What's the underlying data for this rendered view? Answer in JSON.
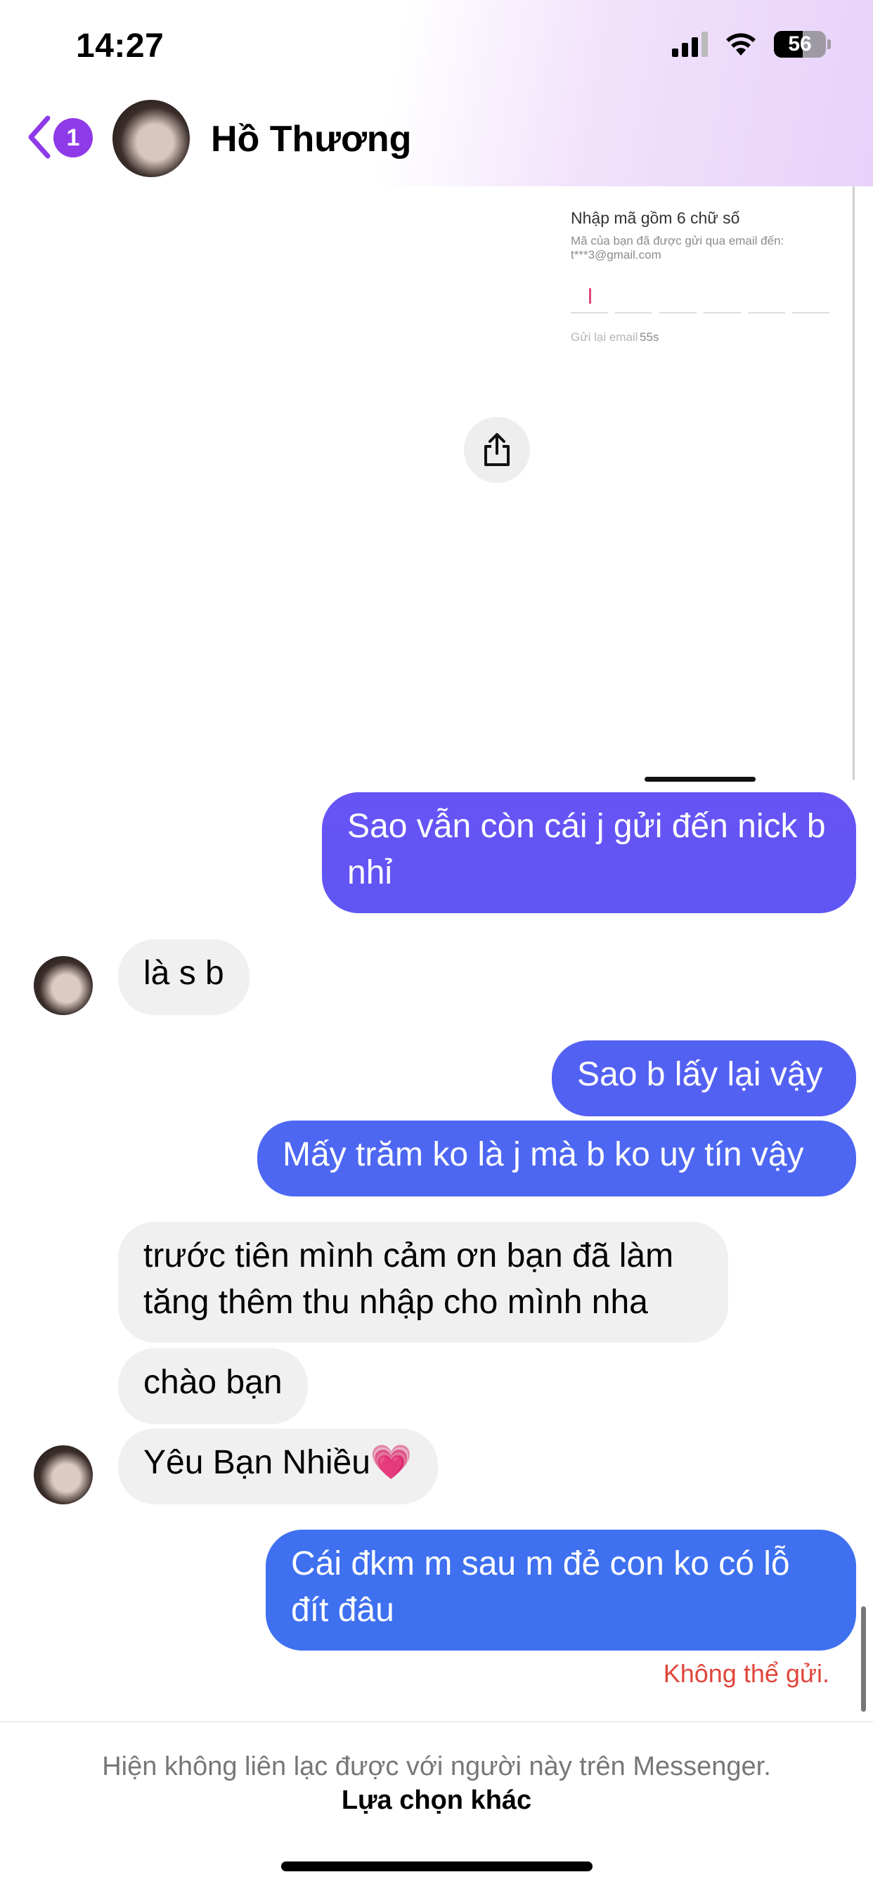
{
  "status": {
    "time": "14:27",
    "battery": "56",
    "battery_level": 0.56
  },
  "header": {
    "unread_count": "1",
    "contact_name": "Hồ Thương"
  },
  "preview": {
    "title": "Nhập mã gồm 6 chữ số",
    "subtitle": "Mã của bạn đã được gửi qua email đến: t***3@gmail.com",
    "resend_label": "Gửi lại email",
    "timer": "55s"
  },
  "messages": [
    {
      "from": "me",
      "text": "Sao vẫn còn cái j gửi đến nick b nhỉ"
    },
    {
      "from": "them",
      "text": "là s b"
    },
    {
      "from": "me",
      "text": "Sao b lấy lại vậy"
    },
    {
      "from": "me",
      "text": "Mấy trăm ko là j mà b ko uy tín vậy"
    },
    {
      "from": "them",
      "text": "trước tiên mình cảm ơn bạn đã làm tăng thêm thu nhập cho mình nha"
    },
    {
      "from": "them",
      "text": "chào bạn"
    },
    {
      "from": "them",
      "text": "Yêu Bạn Nhiều💗"
    },
    {
      "from": "me",
      "text": "Cái đkm m sau m đẻ con ko có lỗ đít đâu"
    }
  ],
  "failed_status": "Không thể gửi.",
  "footer": {
    "notice": "Hiện không liên lạc được với người này trên Messenger.",
    "action": "Lựa chọn khác"
  },
  "colors": {
    "accent": "#8f3ae8",
    "bubble_top": "#6b4ef6",
    "bubble_bottom": "#3f6ff0",
    "incoming": "#f0f0f0",
    "error": "#e0463c"
  }
}
